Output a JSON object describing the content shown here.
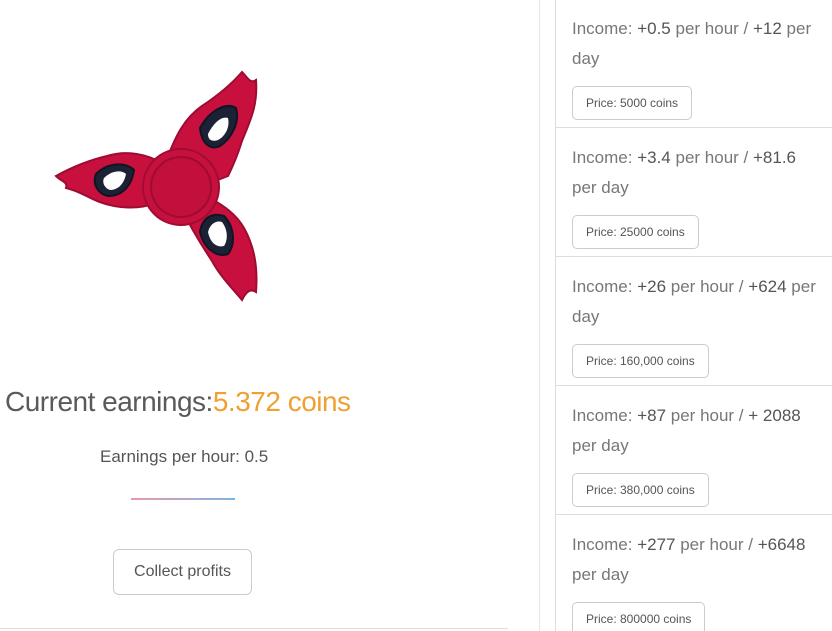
{
  "earnings": {
    "label": "Current earnings:",
    "amount": "5.372 coins",
    "per_hour_text": "Earnings per hour: 0.5"
  },
  "actions": {
    "collect_label": "Collect profits"
  },
  "colors": {
    "accent": "#f0a030",
    "spinner_body": "#c8103e",
    "spinner_cutout": "#1c2236"
  },
  "upgrades": [
    {
      "income_prefix": "Income: ",
      "hour_value": "+0.5",
      "hour_unit": " per hour / ",
      "day_value": "+12",
      "day_unit": " per day",
      "price": "Price: 5000 coins"
    },
    {
      "income_prefix": "Income: ",
      "hour_value": "+3.4",
      "hour_unit": " per hour / ",
      "day_value": "+81.6",
      "day_unit": " per day",
      "price": "Price: 25000 coins"
    },
    {
      "income_prefix": "Income: ",
      "hour_value": "+26",
      "hour_unit": " per hour / ",
      "day_value": "+624",
      "day_unit": " per day",
      "price": "Price: 160,000 coins"
    },
    {
      "income_prefix": "Income: ",
      "hour_value": "+87",
      "hour_unit": " per hour / ",
      "day_value": "+ 2088",
      "day_unit": " per day",
      "price": "Price: 380,000 coins"
    },
    {
      "income_prefix": "Income: ",
      "hour_value": "+277",
      "hour_unit": " per hour / ",
      "day_value": "+6648",
      "day_unit": " per day",
      "price": "Price: 800000 coins"
    }
  ]
}
